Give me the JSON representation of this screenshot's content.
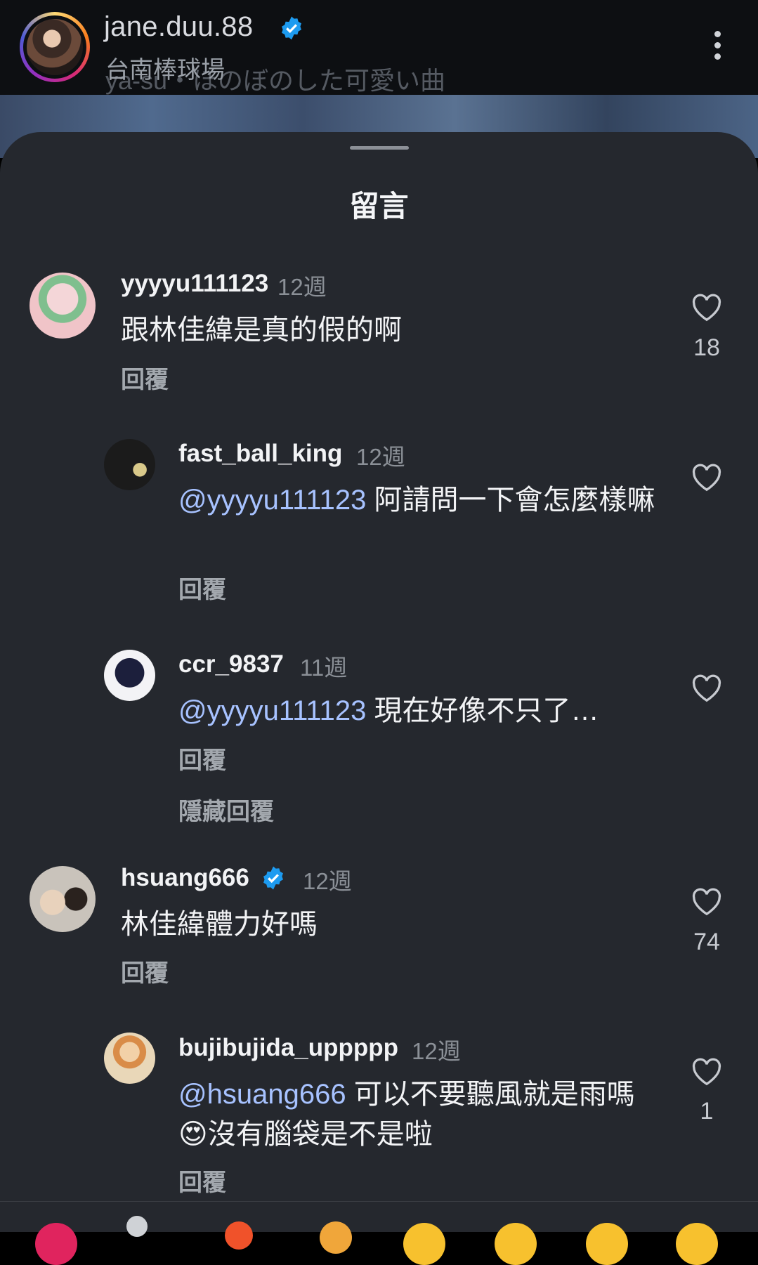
{
  "header": {
    "username": "jane.duu.88",
    "location": "台南棒球場",
    "music": "ya-su・ほのぼのした可愛い曲"
  },
  "sheet": {
    "title": "留言",
    "hide_replies": "隱藏回覆"
  },
  "comments": [
    {
      "username": "yyyyu111123",
      "time": "12週",
      "text": "跟林佳緯是真的假的啊",
      "reply": "回覆",
      "likes": "18"
    },
    {
      "username": "fast_ball_king",
      "time": "12週",
      "mention": "@yyyyu111123",
      "text": "阿請問一下會怎麼樣嘛",
      "reply": "回覆",
      "likes": ""
    },
    {
      "username": "ccr_9837",
      "time": "11週",
      "mention": "@yyyyu111123",
      "text": "現在好像不只了…",
      "reply": "回覆",
      "likes": ""
    },
    {
      "username": "hsuang666",
      "time": "12週",
      "text": "林佳緯體力好嗎",
      "reply": "回覆",
      "likes": "74",
      "verified": true
    },
    {
      "username": "bujibujida_uppppp",
      "time": "12週",
      "mention": "@hsuang666",
      "text": "可以不要聽風就是雨嗎 😍沒有腦袋是不是啦",
      "reply": "回覆",
      "likes": "1"
    }
  ],
  "colors": {
    "sheet_bg": "#25282e",
    "mention": "#a7c2ff",
    "verified": "#1d9bf0"
  },
  "icons": [
    "more-icon",
    "heart-icon",
    "verified-badge-icon"
  ]
}
